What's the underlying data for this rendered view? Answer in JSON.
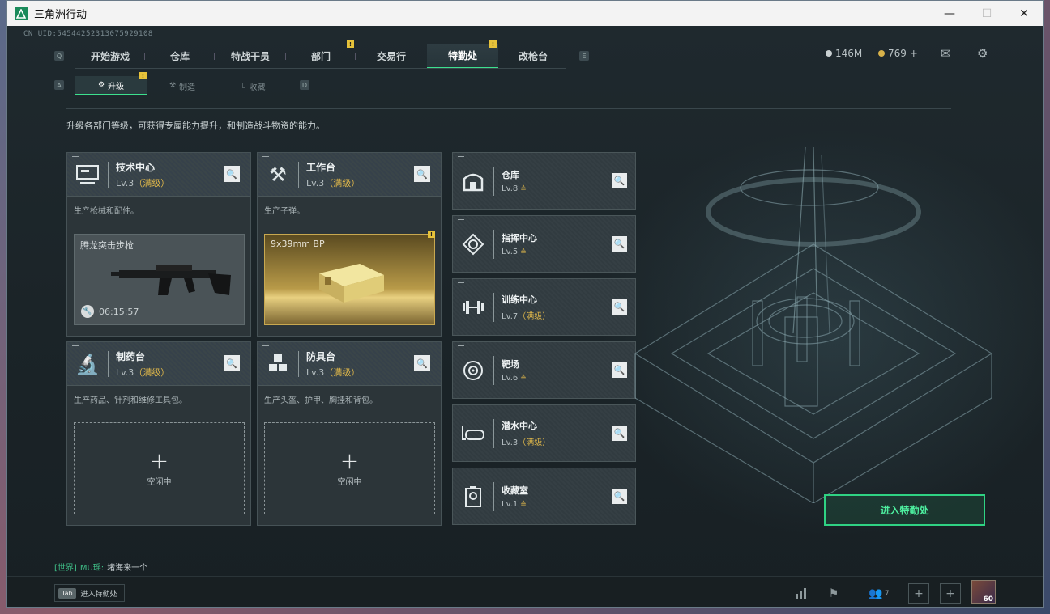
{
  "window": {
    "title": "三角洲行动",
    "min": "—",
    "max": "☐",
    "close": "✕"
  },
  "uid": "CN UID:545442523130759291​08",
  "nav": {
    "q_key": "Q",
    "e_key": "E",
    "tabs": [
      {
        "label": "开始游戏"
      },
      {
        "label": "仓库"
      },
      {
        "label": "特战干员"
      },
      {
        "label": "部门",
        "badge": "!"
      },
      {
        "label": "交易行"
      },
      {
        "label": "特勤处",
        "badge": "!",
        "active": true
      },
      {
        "label": "改枪台"
      }
    ]
  },
  "currency": {
    "silver": "146M",
    "gold": "769 +"
  },
  "subnav": {
    "a_key": "A",
    "d_key": "D",
    "tabs": [
      {
        "label": "升级",
        "icon": "⚙",
        "badge": "!"
      },
      {
        "label": "制造",
        "icon": "⚒"
      },
      {
        "label": "收藏",
        "icon": "▯"
      }
    ]
  },
  "description": "升级各部门等级，可获得专属能力提升，和制造战斗物资的能力。",
  "cards": {
    "tech": {
      "name": "技术中心",
      "lv": "Lv.3",
      "max": "（满级）",
      "desc": "生产枪械和配件。",
      "item": "腾龙突击步枪",
      "timer": "06:15:57"
    },
    "workbench": {
      "name": "工作台",
      "lv": "Lv.3",
      "max": "（满级）",
      "desc": "生产子弹。",
      "item": "9x39mm BP",
      "badge": "!"
    },
    "pharmacy": {
      "name": "制药台",
      "lv": "Lv.3",
      "max": "（满级）",
      "desc": "生产药品、针剂和维修工具包。",
      "idle": "空闲中"
    },
    "armor": {
      "name": "防具台",
      "lv": "Lv.3",
      "max": "（满级）",
      "desc": "生产头盔、护甲、胸挂和背包。",
      "idle": "空闲中"
    }
  },
  "facilities": [
    {
      "name": "仓库",
      "lv": "Lv.8",
      "up": "≙"
    },
    {
      "name": "指挥中心",
      "lv": "Lv.5",
      "up": "≙"
    },
    {
      "name": "训练中心",
      "lv": "Lv.7",
      "max": "（满级）"
    },
    {
      "name": "靶场",
      "lv": "Lv.6",
      "up": "≙"
    },
    {
      "name": "潜水中心",
      "lv": "Lv.3",
      "max": "（满级）"
    },
    {
      "name": "收藏室",
      "lv": "Lv.1",
      "up": "≙"
    }
  ],
  "enter_button": "进入特勤处",
  "chat": {
    "channel": "[世界]",
    "user": "MU瑶:",
    "message": "堵海来一个"
  },
  "bottom": {
    "tab_key": "Tab",
    "tab_label": "进入特勤处",
    "friends_count": "7",
    "avatar_level": "60"
  }
}
